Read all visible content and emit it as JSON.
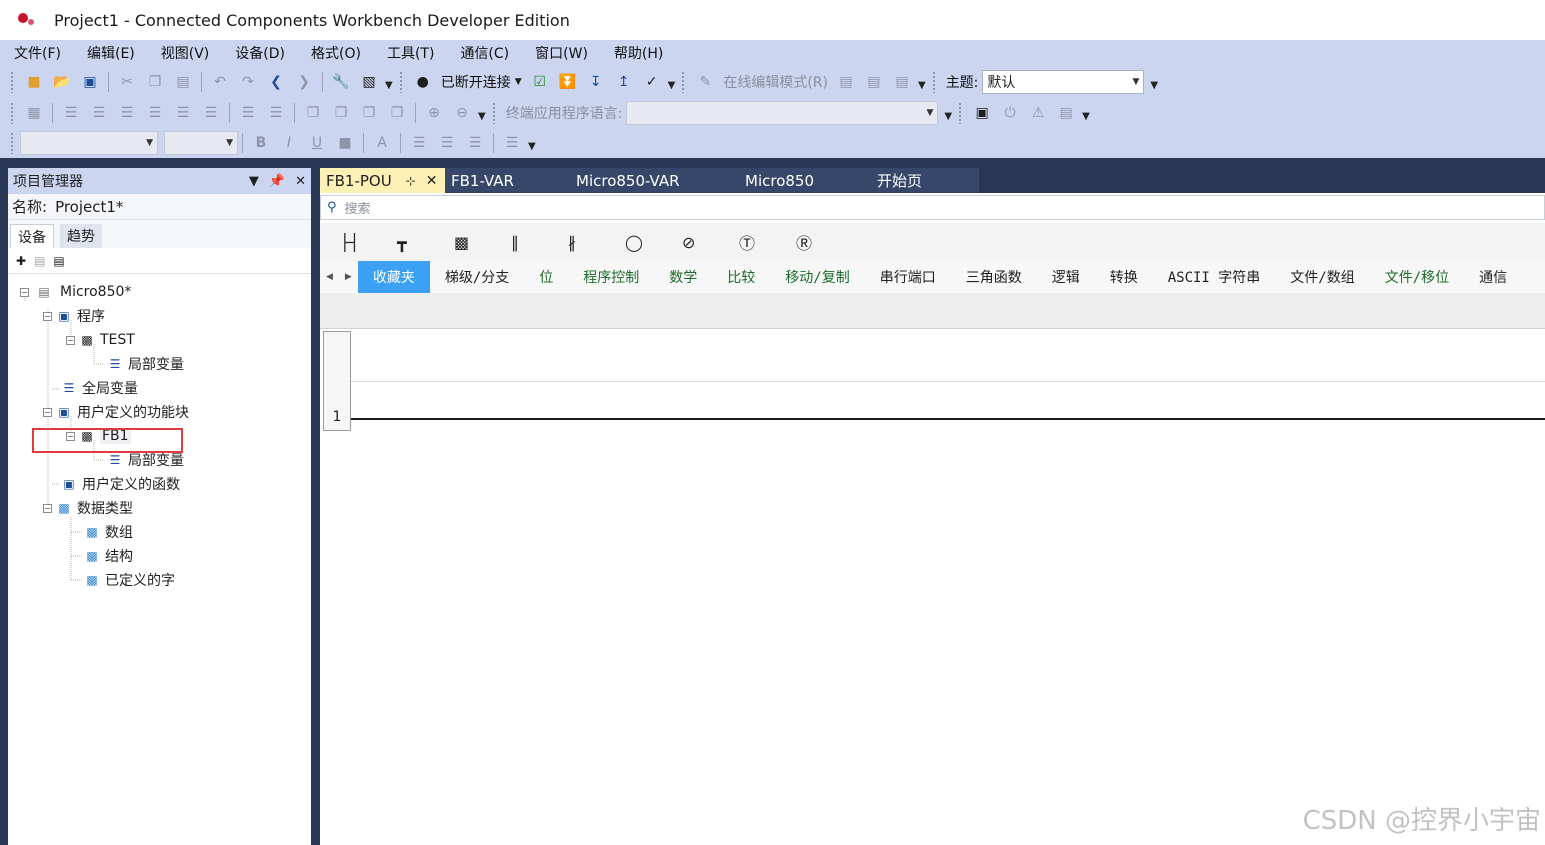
{
  "window": {
    "title": "Project1 - Connected Components Workbench Developer Edition"
  },
  "menu": [
    "文件(F)",
    "编辑(E)",
    "视图(V)",
    "设备(D)",
    "格式(O)",
    "工具(T)",
    "通信(C)",
    "窗口(W)",
    "帮助(H)"
  ],
  "toolbar": {
    "connection_label": "已断开连接",
    "online_edit_label": "在线编辑模式(R)",
    "theme_label": "主题:",
    "theme_value": "默认",
    "terminal_lang_label": "终端应用程序语言:"
  },
  "project_manager": {
    "title": "项目管理器",
    "name_label": "名称:",
    "name_value": "Project1*",
    "tabs": [
      "设备",
      "趋势"
    ],
    "tree": [
      {
        "label": "Micro850*",
        "icon": "controller-icon"
      },
      {
        "label": "程序",
        "icon": "programs-folder-icon"
      },
      {
        "label": "TEST",
        "icon": "program-icon"
      },
      {
        "label": "局部变量",
        "icon": "variables-icon"
      },
      {
        "label": "全局变量",
        "icon": "variables-icon"
      },
      {
        "label": "用户定义的功能块",
        "icon": "function-block-folder-icon"
      },
      {
        "label": "FB1",
        "icon": "program-icon"
      },
      {
        "label": "局部变量",
        "icon": "variables-icon"
      },
      {
        "label": "用户定义的函数",
        "icon": "function-folder-icon"
      },
      {
        "label": "数据类型",
        "icon": "datatype-folder-icon"
      },
      {
        "label": "数组",
        "icon": "datatype-icon"
      },
      {
        "label": "结构",
        "icon": "datatype-icon"
      },
      {
        "label": "已定义的字",
        "icon": "datatype-icon"
      }
    ]
  },
  "editor": {
    "tabs": [
      "FB1-POU",
      "FB1-VAR",
      "Micro850-VAR",
      "Micro850",
      "开始页"
    ],
    "search_placeholder": "搜索",
    "categories": [
      "收藏夹",
      "梯级/分支",
      "位",
      "程序控制",
      "数学",
      "比较",
      "移动/复制",
      "串行端口",
      "三角函数",
      "逻辑",
      "转换",
      "ASCII 字符串",
      "文件/数组",
      "文件/移位",
      "通信"
    ],
    "rung_number": "1"
  },
  "colors": {
    "accent": "#3ca0f5",
    "highlight_border": "#e0393e",
    "dock_dark": "#293955",
    "active_tab": "#fff1b5"
  },
  "watermark": "CSDN @控界小宇宙"
}
